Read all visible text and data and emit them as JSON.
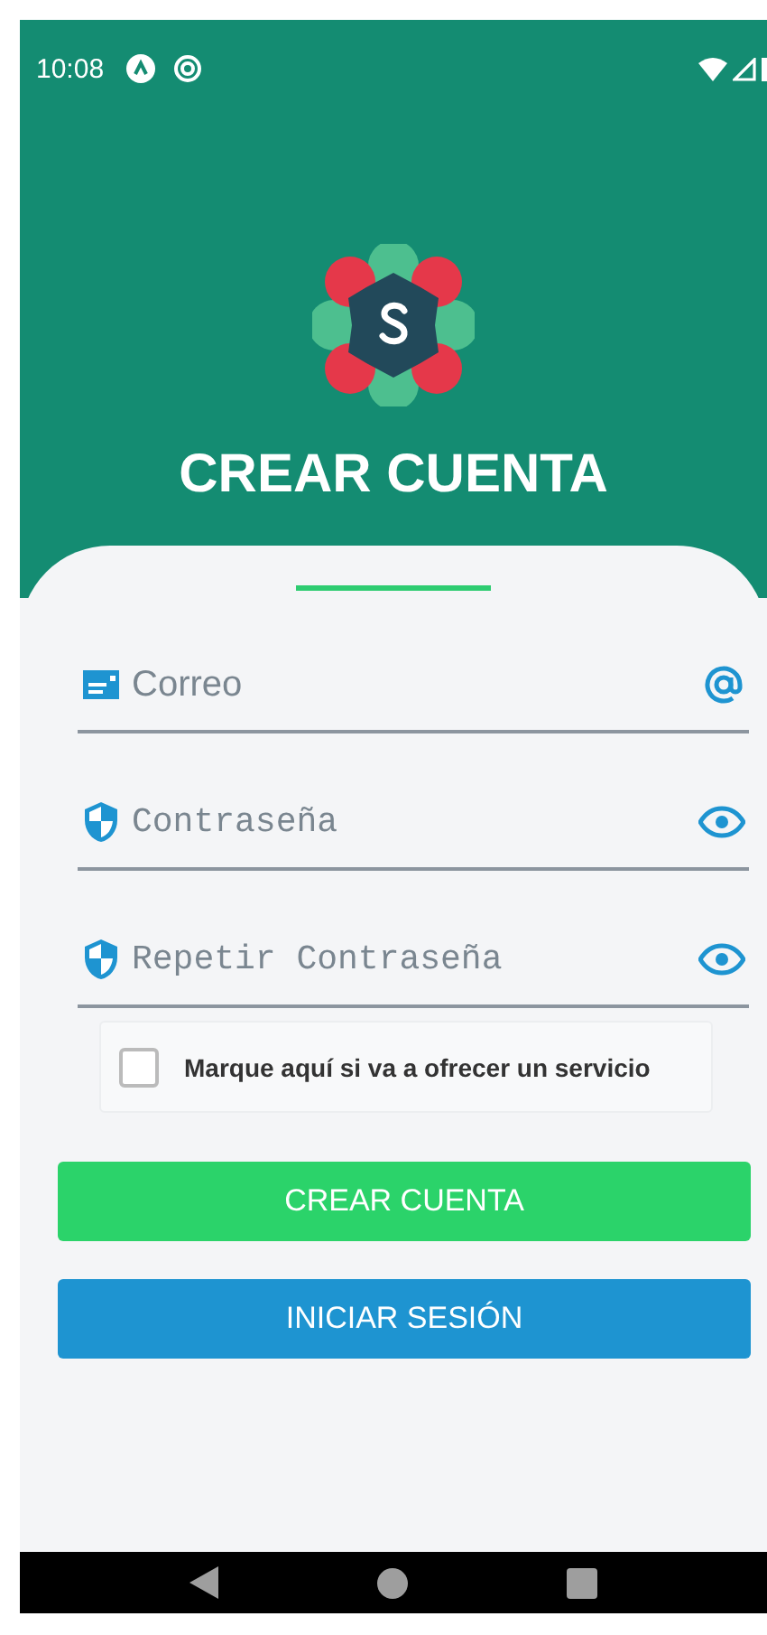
{
  "status_bar": {
    "time": "10:08"
  },
  "header": {
    "title": "CREAR CUENTA"
  },
  "form": {
    "fields": [
      {
        "kind": "email",
        "placeholder": "Correo"
      },
      {
        "kind": "password",
        "placeholder": "Contraseña"
      },
      {
        "kind": "password",
        "placeholder": "Repetir Contraseña"
      }
    ],
    "checkbox": {
      "label": "Marque aquí si va a ofrecer un servicio",
      "checked": false
    },
    "buttons": [
      {
        "kind": "primary",
        "label": "CREAR CUENTA"
      },
      {
        "kind": "secondary",
        "label": "INICIAR SESIÓN"
      }
    ]
  }
}
